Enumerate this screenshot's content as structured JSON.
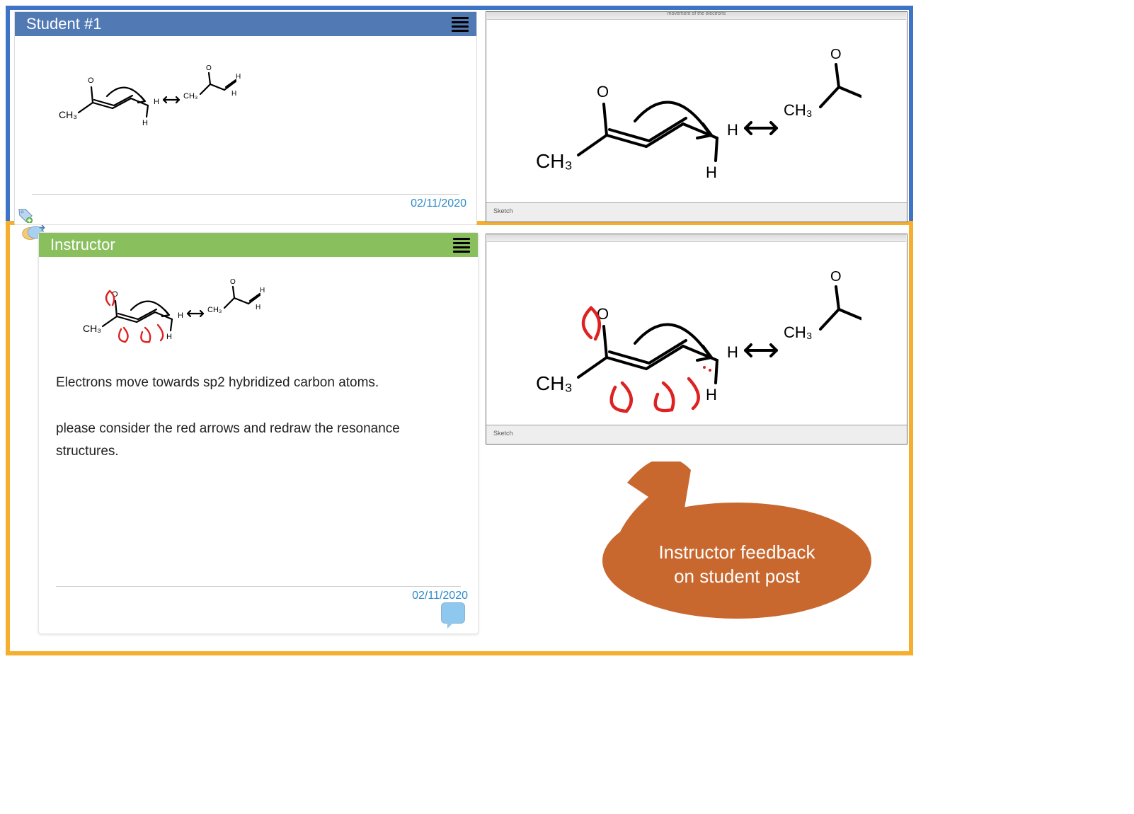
{
  "student_post": {
    "title": "Student #1",
    "date": "02/11/2020"
  },
  "instructor_post": {
    "title": "Instructor",
    "body_line1": "Electrons move towards sp2 hybridized carbon atoms.",
    "body_line2": "please consider the red arrows and redraw the resonance structures.",
    "date": "02/11/2020"
  },
  "preview": {
    "sketch_label": "Sketch",
    "tiny_top_label": "movement of the electrons"
  },
  "callout": {
    "line1": "Instructor feedback",
    "line2": "on student post"
  },
  "colors": {
    "frame_blue": "#3d74c5",
    "frame_orange": "#f6ae2f",
    "student_bar": "#5179b3",
    "instructor_bar": "#89c05d",
    "callout_fill": "#c8682f"
  }
}
